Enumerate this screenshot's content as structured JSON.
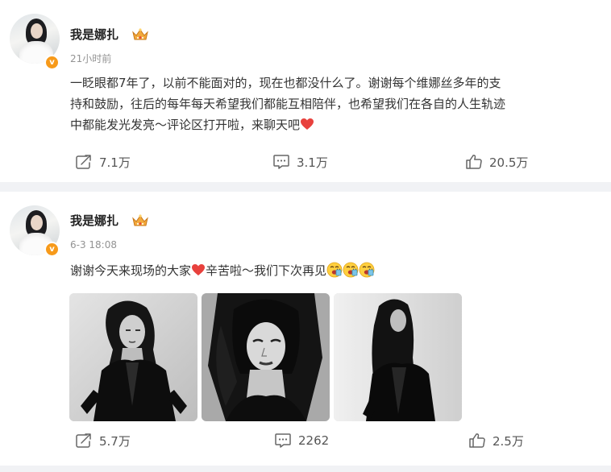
{
  "posts": [
    {
      "username": "我是娜扎",
      "timestamp": "21小时前",
      "text_lines": [
        "一眨眼都7年了，以前不能面对的，现在也都没什么了。谢谢每个维娜丝多年的支",
        "持和鼓励，往后的每年每天希望我们都能互相陪伴，也希望我们在各自的人生轨迹",
        "中都能发光发亮～评论区打开啦，来聊天吧"
      ],
      "actions": {
        "repost": "7.1万",
        "comment": "3.1万",
        "like": "20.5万"
      }
    },
    {
      "username": "我是娜扎",
      "timestamp": "6-3 18:08",
      "text_part1": "谢谢今天来现场的大家",
      "text_part2": "辛苦啦～我们下次再见",
      "images": [
        "photo-1",
        "photo-2",
        "photo-3"
      ],
      "actions": {
        "repost": "5.7万",
        "comment": "2262",
        "like": "2.5万"
      }
    }
  ],
  "badges": {
    "verified": "v"
  },
  "icons": {
    "verified": "verified-badge-icon",
    "crown": "crown-icon",
    "repost": "repost-icon",
    "comment": "comment-icon",
    "like": "like-icon",
    "heart": "heart-emoji-icon",
    "cheer": "cheer-emoji-icon"
  },
  "colors": {
    "page_bg": "#f1f2f5",
    "card_bg": "#ffffff",
    "verified_badge": "#f79a1a",
    "crown": "#f2a93b",
    "heart": "#e8413d",
    "text": "#333333",
    "muted": "#939393"
  }
}
